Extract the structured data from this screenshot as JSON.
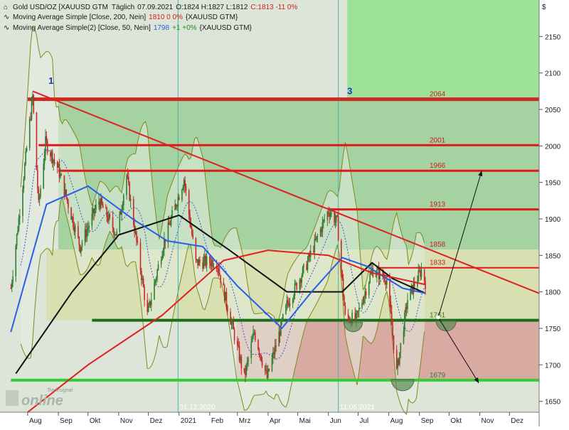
{
  "header": {
    "line1": {
      "symbol": "Gold USD/OZ [XAUUSD GTM",
      "period": "Täglich",
      "date": "07.09.2021",
      "ohlc": "O:1824 H:1827 L:1812",
      "close": "C:1813 -11 0%"
    },
    "line2": {
      "study": "Moving Average Simple [Close, 200, Nein]",
      "value": "1810 0 0%",
      "symbol": "{XAUUSD GTM}"
    },
    "line3": {
      "study": "Moving Average Simple(2) [Close, 50, Nein]",
      "value": "1798",
      "change": "+1 +0%",
      "symbol": "{XAUUSD GTM}"
    }
  },
  "currency_symbol": "$",
  "logo": {
    "small": "Tradesignal",
    "large": "online"
  },
  "colors": {
    "up": "#2e7d32",
    "down": "#c62828",
    "bg": "#dde5d9"
  },
  "chart_data": {
    "type": "candlestick",
    "title": "Gold USD/OZ [XAUUSD GTM",
    "ylim": [
      1635,
      2200
    ],
    "y_ticks": [
      1650,
      1700,
      1750,
      1800,
      1850,
      1900,
      1950,
      2000,
      2050,
      2100,
      2150
    ],
    "x_ticks": [
      "Aug",
      "Sep",
      "Okt",
      "Nov",
      "Dez",
      "2021",
      "Feb",
      "Mrz",
      "Apr",
      "Mai",
      "Jun",
      "Jul",
      "Aug",
      "Sep",
      "Okt",
      "Nov",
      "Dez"
    ],
    "x_range": [
      "2020-08-01",
      "2021-12-31"
    ],
    "price_path": [
      {
        "d": "2020-07-15",
        "v": 1805
      },
      {
        "d": "2020-07-28",
        "v": 1960
      },
      {
        "d": "2020-08-06",
        "v": 2068
      },
      {
        "d": "2020-08-12",
        "v": 1918
      },
      {
        "d": "2020-08-19",
        "v": 2005
      },
      {
        "d": "2020-09-01",
        "v": 1968
      },
      {
        "d": "2020-09-23",
        "v": 1862
      },
      {
        "d": "2020-10-12",
        "v": 1925
      },
      {
        "d": "2020-10-30",
        "v": 1878
      },
      {
        "d": "2020-11-09",
        "v": 1960
      },
      {
        "d": "2020-11-30",
        "v": 1768
      },
      {
        "d": "2020-12-16",
        "v": 1865
      },
      {
        "d": "2021-01-06",
        "v": 1955
      },
      {
        "d": "2021-01-18",
        "v": 1840
      },
      {
        "d": "2021-02-08",
        "v": 1842
      },
      {
        "d": "2021-03-08",
        "v": 1683
      },
      {
        "d": "2021-03-18",
        "v": 1745
      },
      {
        "d": "2021-03-31",
        "v": 1682
      },
      {
        "d": "2021-04-20",
        "v": 1782
      },
      {
        "d": "2021-05-10",
        "v": 1838
      },
      {
        "d": "2021-06-01",
        "v": 1912
      },
      {
        "d": "2021-06-10",
        "v": 1895
      },
      {
        "d": "2021-06-18",
        "v": 1765
      },
      {
        "d": "2021-06-29",
        "v": 1762
      },
      {
        "d": "2021-07-15",
        "v": 1830
      },
      {
        "d": "2021-07-30",
        "v": 1818
      },
      {
        "d": "2021-08-09",
        "v": 1690
      },
      {
        "d": "2021-08-20",
        "v": 1790
      },
      {
        "d": "2021-09-03",
        "v": 1830
      },
      {
        "d": "2021-09-07",
        "v": 1813
      }
    ],
    "series": [
      {
        "name": "Moving Average Simple [Close, 200, Nein]",
        "color": "#e02020",
        "points": [
          {
            "d": "2020-08-01",
            "v": 1635
          },
          {
            "d": "2020-10-01",
            "v": 1700
          },
          {
            "d": "2020-12-15",
            "v": 1768
          },
          {
            "d": "2021-02-15",
            "v": 1843
          },
          {
            "d": "2021-04-01",
            "v": 1857
          },
          {
            "d": "2021-06-01",
            "v": 1850
          },
          {
            "d": "2021-07-15",
            "v": 1826
          },
          {
            "d": "2021-09-07",
            "v": 1810
          }
        ]
      },
      {
        "name": "Moving Average Simple(2) [Close, 50, Nein]",
        "color": "#2a5ee8",
        "points": [
          {
            "d": "2020-07-15",
            "v": 1745
          },
          {
            "d": "2020-08-20",
            "v": 1920
          },
          {
            "d": "2020-10-01",
            "v": 1945
          },
          {
            "d": "2020-11-15",
            "v": 1900
          },
          {
            "d": "2020-12-20",
            "v": 1870
          },
          {
            "d": "2021-01-25",
            "v": 1862
          },
          {
            "d": "2021-03-01",
            "v": 1808
          },
          {
            "d": "2021-04-15",
            "v": 1750
          },
          {
            "d": "2021-05-15",
            "v": 1800
          },
          {
            "d": "2021-06-15",
            "v": 1847
          },
          {
            "d": "2021-07-10",
            "v": 1835
          },
          {
            "d": "2021-08-15",
            "v": 1805
          },
          {
            "d": "2021-09-07",
            "v": 1798
          }
        ]
      }
    ],
    "moving_average_100": {
      "color": "#111111",
      "points": [
        {
          "d": "2020-07-20",
          "v": 1688
        },
        {
          "d": "2020-09-15",
          "v": 1800
        },
        {
          "d": "2020-11-01",
          "v": 1878
        },
        {
          "d": "2021-01-01",
          "v": 1905
        },
        {
          "d": "2021-02-20",
          "v": 1858
        },
        {
          "d": "2021-04-20",
          "v": 1800
        },
        {
          "d": "2021-06-15",
          "v": 1800
        },
        {
          "d": "2021-07-15",
          "v": 1840
        },
        {
          "d": "2021-08-05",
          "v": 1818
        },
        {
          "d": "2021-09-07",
          "v": 1798
        }
      ]
    },
    "horizontal_levels": [
      {
        "value": 2064,
        "label": "2064",
        "color": "#cc2a1f",
        "start": "2020-08-01",
        "width": 5
      },
      {
        "value": 2001,
        "label": "2001",
        "color": "#e01818",
        "start": "2020-08-12",
        "width": 3
      },
      {
        "value": 1966,
        "label": "1966",
        "color": "#e01818",
        "start": "2020-09-01",
        "width": 3
      },
      {
        "value": 1913,
        "label": "1913",
        "color": "#e01818",
        "start": "2021-06-01",
        "width": 3
      },
      {
        "value": 1858,
        "label": "1858",
        "color": "#e01818",
        "start": "2021-06-01",
        "width": 0
      },
      {
        "value": 1833,
        "label": "1833",
        "color": "#e01818",
        "start": "2021-07-20",
        "width": 2
      },
      {
        "value": 1761,
        "label": "1761",
        "color": "#1a6e1a",
        "start": "2020-10-05",
        "width": 4
      },
      {
        "value": 1679,
        "label": "1679",
        "color": "#33cc33",
        "start": "2020-07-15",
        "width": 4
      }
    ],
    "trendline": {
      "color": "#e02020",
      "from": {
        "d": "2020-08-06",
        "v": 2075
      },
      "to": {
        "d": "2021-12-31",
        "v": 1798
      }
    },
    "zones": [
      {
        "from": {
          "d": "2021-06-20",
          "v": 2064
        },
        "to": {
          "d": "2021-12-31",
          "v": 2200
        },
        "color": "#9ee29a"
      },
      {
        "from": {
          "d": "2020-09-01",
          "v": 1858
        },
        "to": {
          "d": "2021-12-31",
          "v": 2064
        },
        "color": "#a4d2a0"
      },
      {
        "from": {
          "d": "2020-08-20",
          "v": 1761
        },
        "to": {
          "d": "2021-12-31",
          "v": 1858
        },
        "color": "#d8dfb0"
      },
      {
        "from": {
          "d": "2021-02-28",
          "v": 1679
        },
        "to": {
          "d": "2021-12-31",
          "v": 1761
        },
        "color": "#d9aaa2"
      }
    ],
    "vertical_markers": [
      {
        "date": "2020-12-31",
        "label": "31.12.2020"
      },
      {
        "date": "2021-06-11",
        "label": "11.06.2021"
      }
    ],
    "wave_labels": [
      {
        "text": "1",
        "d": "2020-08-22",
        "v": 2085
      },
      {
        "text": "3",
        "d": "2021-06-20",
        "v": 2071
      }
    ],
    "forecast_arrows": [
      {
        "from": {
          "d": "2021-09-20",
          "v": 1765
        },
        "to": {
          "d": "2021-11-03",
          "v": 1966
        }
      },
      {
        "from": {
          "d": "2021-09-20",
          "v": 1765
        },
        "to": {
          "d": "2021-10-31",
          "v": 1675
        }
      }
    ]
  }
}
